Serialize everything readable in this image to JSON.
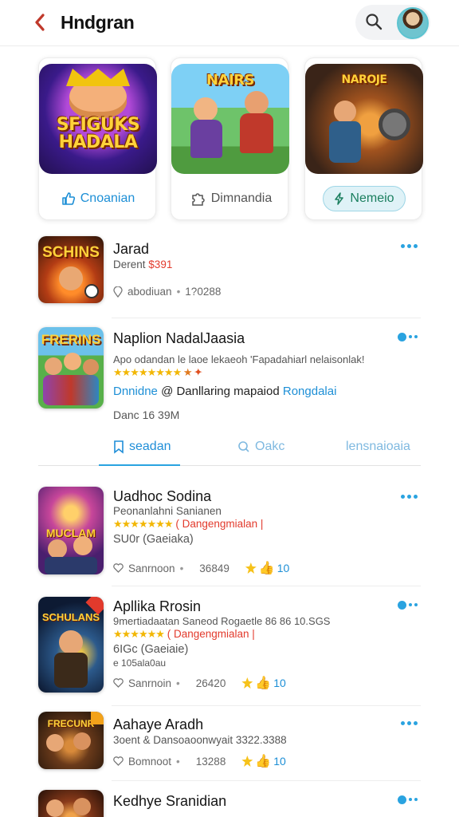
{
  "header": {
    "title": "Hndgran",
    "back_icon": "chevron-left-icon",
    "search_icon": "search-icon",
    "avatar_icon": "user-avatar"
  },
  "featured": [
    {
      "art": "SFIGUKS\nHADALA",
      "button": "Cnoanian",
      "icon": "thumbs-up-icon",
      "style": "outline"
    },
    {
      "art": "NAIRS",
      "button": "Dimnandia",
      "icon": "puzzle-icon",
      "style": "outline"
    },
    {
      "art": "NAROJE",
      "button": "Nemeio",
      "icon": "bolt-icon",
      "style": "filled"
    }
  ],
  "items": [
    {
      "art": "SCHINS",
      "title": "Jarad",
      "sub_prefix": "Derent",
      "sub_value": "$391",
      "meta_label": "abodiuan",
      "meta_value": "1?0288"
    },
    {
      "art": "FRERINS",
      "title": "Naplion NadalJaasia",
      "line1": "Apo odandan le laoe lekaeoh 'Fapadahiarl nelaisonlak!",
      "line2_prefix": "Dnnidne",
      "line2_mid": "@ Danllaring mapaiod",
      "line2_suffix": "Rongdalai",
      "meta": "Danc  16   39M"
    },
    {
      "art": "MUCLAM",
      "title": "Uadhoc Sodina",
      "line1": "Peonanlahni Sanianen",
      "line2": "( Dangengmialan |",
      "line3": "SU0r (Gaeiaka)",
      "meta_label": "Sanrnoon",
      "meta_value": "36849",
      "rating": "10"
    },
    {
      "art": "SCHULANS",
      "title": "Apllika Rrosin",
      "line1": "9mertiadaatan Saneod Rogaetle 86 86 10.SGS",
      "line2": "( Dangengmialan |",
      "line3": "6IGc (Gaeiaie)",
      "line4": "e 105ala0au",
      "meta_label": "Sanrnoin",
      "meta_value": "26420",
      "rating": "10"
    },
    {
      "art": "FRECUNR",
      "title": "Aahaye Aradh",
      "line1": "3oent  & Dansoaoonwyait  3322.3388",
      "meta_label": "Bomnoot",
      "meta_value": "13288",
      "rating": "10"
    },
    {
      "art": "",
      "title": "Kedhye Sranidian",
      "line1": ""
    }
  ],
  "tabs": [
    {
      "label": "seadan",
      "icon": "bookmark-icon"
    },
    {
      "label": "Oakc",
      "icon": "search-icon"
    },
    {
      "label": "lensnaioaia",
      "icon": ""
    }
  ],
  "colors": {
    "accent": "#1d8fd6",
    "red": "#e23a2c",
    "star": "#f2b705"
  }
}
